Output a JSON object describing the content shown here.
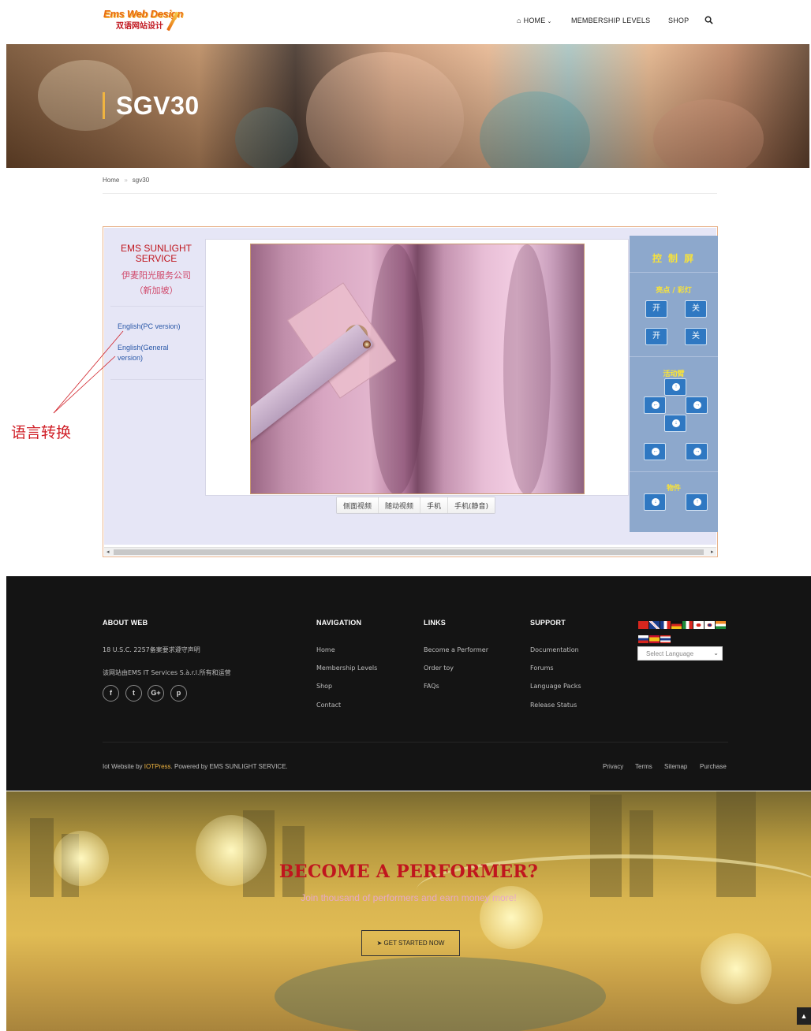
{
  "header": {
    "logo_line1": "Ems Web Design",
    "logo_line2": "双语网站设计",
    "nav": {
      "home": "HOME",
      "membership": "MEMBERSHIP LEVELS",
      "shop": "SHOP"
    }
  },
  "hero": {
    "title": "SGV30"
  },
  "breadcrumb": {
    "home": "Home",
    "current": "sgv30"
  },
  "widget": {
    "brand_en": "EMS SUNLIGHT SERVICE",
    "brand_cn_line1": "伊麦阳光服务公司",
    "brand_cn_line2": "（新加坡）",
    "lang_pc": "English(PC version)",
    "lang_general_line1": "English(General",
    "lang_general_line2": "version)",
    "video_tabs": [
      "侧面视频",
      "随动视频",
      "手机",
      "手机(静音)"
    ],
    "control": {
      "title": "控 制 屏",
      "section_light": "亮点 / 彩灯",
      "on_label": "开",
      "off_label": "关",
      "section_arm": "活动臂",
      "section_item": "物件"
    }
  },
  "annotation": {
    "label": "语言转换",
    "color": "#d02028"
  },
  "footer": {
    "about_title": "ABOUT WEB",
    "about_line1": "18 U.S.C. 2257备案要求遵守声明",
    "about_line2": "该网站由EMS IT Services S.à.r.l.所有和运营",
    "nav_title": "NAVIGATION",
    "nav_items": [
      "Home",
      "Membership Levels",
      "Shop",
      "Contact"
    ],
    "links_title": "LINKS",
    "links_items": [
      "Become a Performer",
      "Order toy",
      "FAQs"
    ],
    "support_title": "SUPPORT",
    "support_items": [
      "Documentation",
      "Forums",
      "Language Packs",
      "Release Status"
    ],
    "select_language": "Select Language",
    "copy_prefix": "Iot Website by ",
    "copy_brand": "IOTPress",
    "copy_suffix": ". Powered by EMS SUNLIGHT SERVICE.",
    "bottom_links": [
      "Privacy",
      "Terms",
      "Sitemap",
      "Purchase"
    ]
  },
  "cta": {
    "title": "BECOME A PERFORMER?",
    "subtitle": "Join thousand of performers and earn money more!",
    "button": "GET STARTED NOW"
  },
  "colors": {
    "accent": "#f0b440",
    "brand_red": "#c0161e",
    "control_bg": "#8da8cc",
    "control_btn": "#2f78c2",
    "footer_bg": "#141414"
  }
}
